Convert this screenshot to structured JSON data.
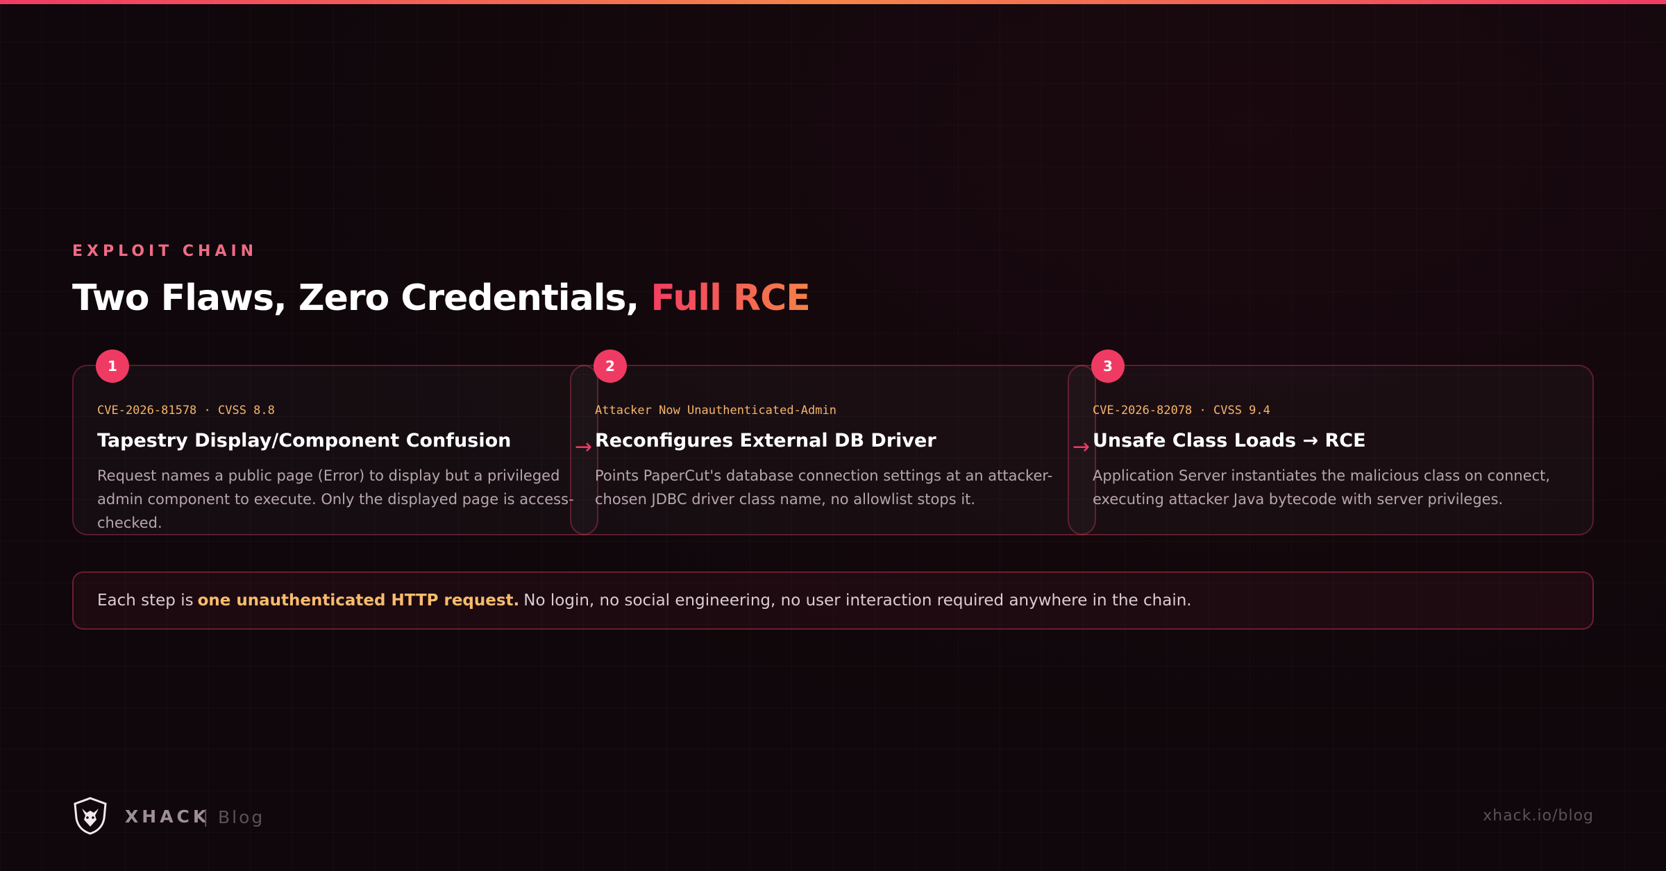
{
  "header": {
    "eyebrow": "EXPLOIT CHAIN",
    "title_main": "Two Flaws, Zero Credentials, ",
    "title_accent": "Full RCE"
  },
  "steps": [
    {
      "number": "1",
      "meta": "CVE-2026-81578 · CVSS 8.8",
      "title": "Tapestry Display/Component Confusion",
      "body": "Request names a public page (Error) to display but a privileged admin component to execute. Only the displayed page is access-checked."
    },
    {
      "number": "2",
      "meta": "Attacker Now Unauthenticated-Admin",
      "title": "Reconfigures External DB Driver",
      "body": "Points PaperCut's database connection settings at an attacker-chosen JDBC driver class name, no allowlist stops it."
    },
    {
      "number": "3",
      "meta": "CVE-2026-82078 · CVSS 9.4",
      "title": "Unsafe Class Loads → RCE",
      "body": "Application Server instantiates the malicious class on connect, executing attacker Java bytecode with server privileges."
    }
  ],
  "arrows": [
    "→",
    "→"
  ],
  "note": {
    "prefix": "Each step is",
    "highlight": "one unauthenticated HTTP request.",
    "suffix": "No login, no social engineering, no user interaction required anywhere in the chain."
  },
  "footer": {
    "brand": "XHACK",
    "separator": "|",
    "section": "Blog",
    "url": "xhack.io/blog"
  },
  "colors": {
    "accent": "#ef3b63",
    "accent_orange": "#f58247",
    "highlight": "#f9bb6d",
    "background": "#0f070b"
  },
  "icons": {
    "logo": "wolf-shield-icon",
    "arrow": "arrow-right-icon"
  }
}
